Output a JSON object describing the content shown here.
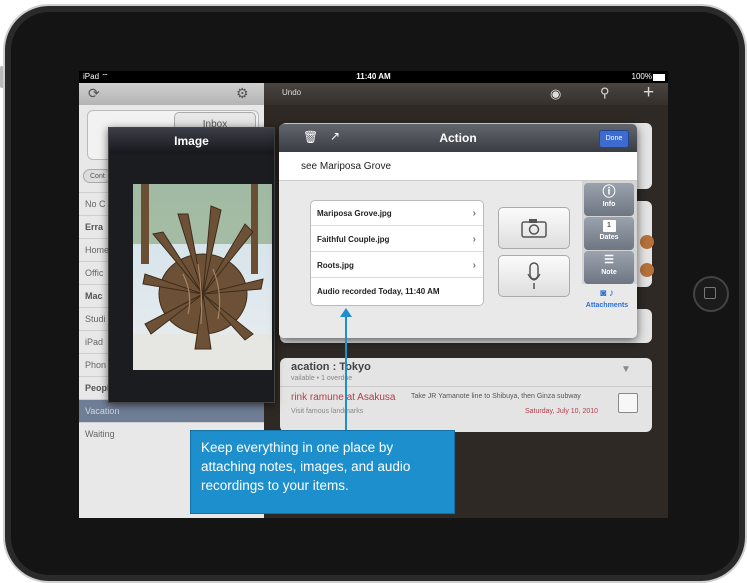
{
  "status_bar": {
    "device": "iPad",
    "time": "11:40 AM",
    "battery": "100%"
  },
  "left_pane": {
    "inbox_label": "Inbox",
    "back_label": "Cont",
    "rows": [
      {
        "label": "No C",
        "bold": false
      },
      {
        "label": "Erra",
        "bold": true
      },
      {
        "label": "Home",
        "bold": false
      },
      {
        "label": "Offic",
        "bold": false
      },
      {
        "label": "Mac",
        "bold": true
      },
      {
        "label": "Studi",
        "bold": false
      },
      {
        "label": "iPad",
        "bold": false
      },
      {
        "label": "Phon",
        "bold": false
      },
      {
        "label": "People",
        "bold": true
      },
      {
        "label": "Vacation",
        "bold": false
      },
      {
        "label": "Waiting",
        "bold": false
      }
    ]
  },
  "right_pane": {
    "undo_label": "Undo",
    "available_label": "vailable",
    "project": {
      "title": "acation : Tokyo",
      "meta": "vailable • 1 overdue"
    },
    "task": {
      "title": "rink ramune at Asakusa",
      "note": "Take JR Yamanote line to Shibuya, then Ginza subway",
      "context": "Visit famous landmarks",
      "date": "Saturday, July 10, 2010"
    }
  },
  "image_popover": {
    "title": "Image"
  },
  "action_popover": {
    "title": "Action",
    "done_label": "Done",
    "task_name": "see Mariposa Grove",
    "attachments": [
      {
        "name": "Mariposa Grove.jpg",
        "has_chevron": true
      },
      {
        "name": "Faithful Couple.jpg",
        "has_chevron": true
      },
      {
        "name": "Roots.jpg",
        "has_chevron": true
      },
      {
        "name": "Audio recorded Today, 11:40 AM",
        "has_chevron": false
      }
    ],
    "tabs": {
      "info": "Info",
      "dates": "Dates",
      "dates_day": "1",
      "note": "Note",
      "attachments": "Attachments"
    }
  },
  "callout": {
    "text": "Keep everything in one place by attaching notes, images, and audio recordings to your items."
  },
  "colors": {
    "accent": "#1d8fcc",
    "done_button": "#3d6bd0",
    "selected_row": "#6f7e96"
  }
}
